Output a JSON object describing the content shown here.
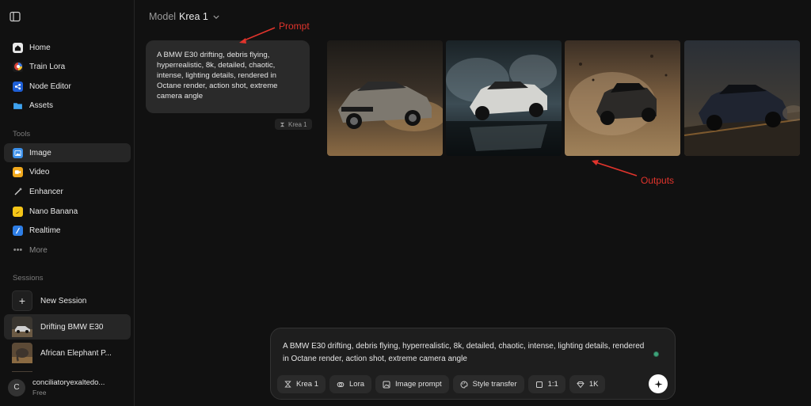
{
  "sidebar": {
    "nav": [
      {
        "label": "Home",
        "icon": "home-icon"
      },
      {
        "label": "Train Lora",
        "icon": "train-lora-icon"
      },
      {
        "label": "Node Editor",
        "icon": "node-editor-icon"
      },
      {
        "label": "Assets",
        "icon": "folder-icon"
      }
    ],
    "tools_label": "Tools",
    "tools": [
      {
        "label": "Image",
        "icon": "image-icon"
      },
      {
        "label": "Video",
        "icon": "video-icon"
      },
      {
        "label": "Enhancer",
        "icon": "enhancer-icon"
      },
      {
        "label": "Nano Banana",
        "icon": "banana-icon"
      },
      {
        "label": "Realtime",
        "icon": "realtime-icon"
      }
    ],
    "more_label": "More",
    "sessions_label": "Sessions",
    "new_session": "New Session",
    "sessions": [
      {
        "label": "Drifting BMW E30"
      },
      {
        "label": "African Elephant P..."
      }
    ],
    "user": {
      "initial": "C",
      "name": "conciliatoryexaltedo...",
      "plan": "Free"
    }
  },
  "main": {
    "model_label": "Model",
    "model_value": "Krea 1",
    "prompt_text": "A BMW E30 drifting, debris flying, hyperrealistic, 8k, detailed, chaotic, intense, lighting details, rendered in Octane render, action shot, extreme camera angle",
    "prompt_model_chip": "Krea 1",
    "annotations": {
      "prompt": "Prompt",
      "outputs": "Outputs"
    }
  },
  "composer": {
    "text": "A BMW E30 drifting, debris flying, hyperrealistic, 8k, detailed, chaotic, intense, lighting details, rendered in Octane render, action shot, extreme camera angle",
    "chips": [
      {
        "label": "Krea 1",
        "icon": "model-icon"
      },
      {
        "label": "Lora",
        "icon": "lora-icon"
      },
      {
        "label": "Image prompt",
        "icon": "image-prompt-icon"
      },
      {
        "label": "Style transfer",
        "icon": "palette-icon"
      },
      {
        "label": "1:1",
        "icon": "aspect-ratio-icon"
      },
      {
        "label": "1K",
        "icon": "diamond-icon"
      }
    ]
  },
  "colors": {
    "accent_annotation": "#e0342c",
    "status_dot": "#3ea37a",
    "background": "#111111"
  }
}
